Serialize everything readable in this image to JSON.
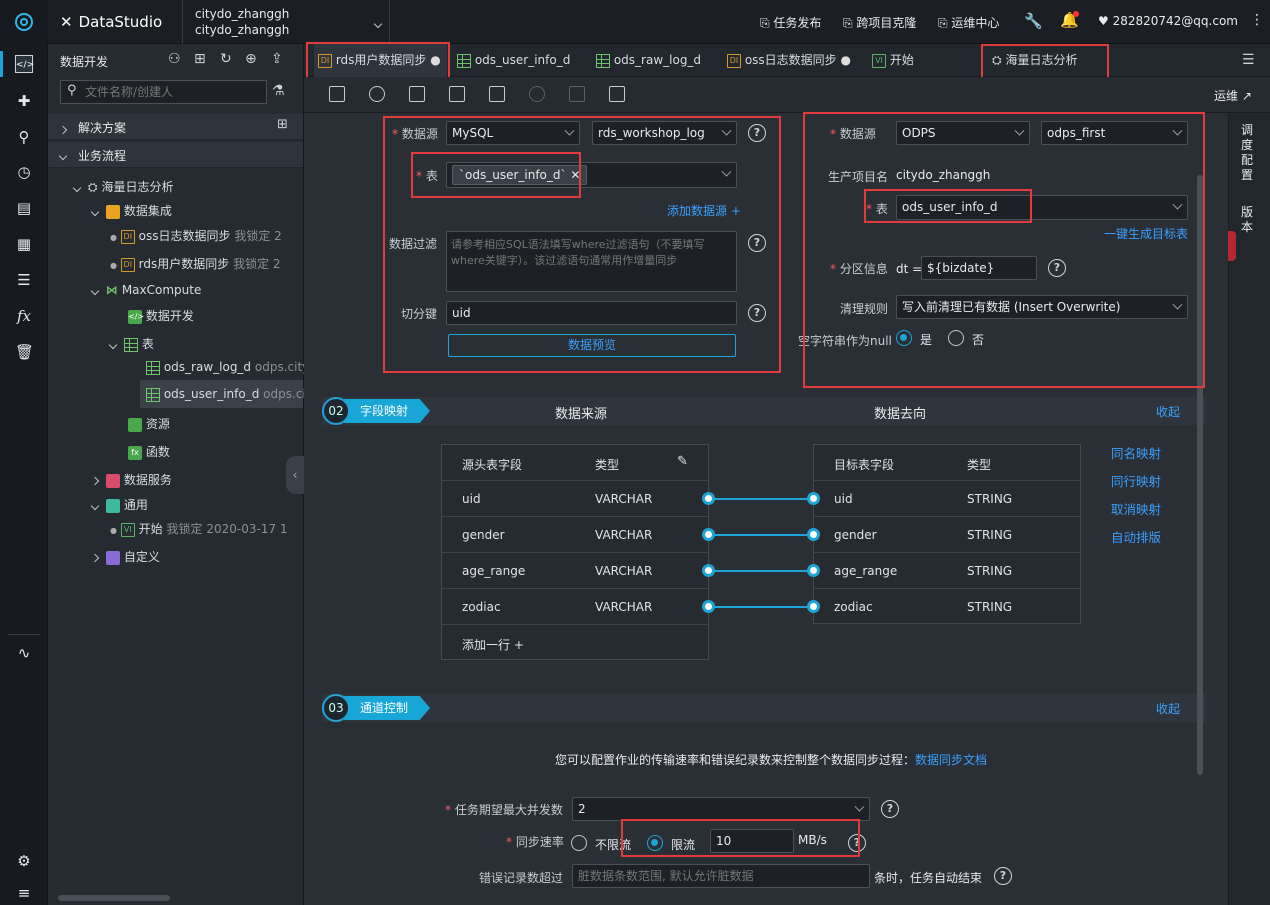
{
  "app": {
    "title": "DataStudio",
    "project_line1": "citydo_zhanggh",
    "project_line2": "citydo_zhanggh"
  },
  "topnav": {
    "task_publish": "任务发布",
    "cross_project_clone": "跨项目克隆",
    "ops_center": "运维中心",
    "user": "282820742@qq.com"
  },
  "sidebar": {
    "title": "数据开发",
    "search_placeholder": "文件名称/创建人",
    "sections": {
      "solutions": "解决方案",
      "business_flow": "业务流程"
    },
    "tree": {
      "flow": "海量日志分析",
      "data_integration": "数据集成",
      "oss_sync": "oss日志数据同步",
      "oss_lock": "我锁定",
      "oss_tail": "2",
      "rds_sync": "rds用户数据同步",
      "rds_lock": "我锁定",
      "rds_tail": "2",
      "maxcompute": "MaxCompute",
      "data_dev": "数据开发",
      "table_group": "表",
      "raw_log": "ods_raw_log_d",
      "raw_log_ns": "odps.city",
      "user_info": "ods_user_info_d",
      "user_info_ns": "odps.ci",
      "resource": "资源",
      "function": "函数",
      "data_service": "数据服务",
      "general": "通用",
      "start": "开始",
      "start_lock": "我锁定",
      "start_time": "2020-03-17 1",
      "custom": "自定义"
    }
  },
  "tabs": [
    {
      "label": "rds用户数据同步",
      "icon": "DI"
    },
    {
      "label": "ods_user_info_d",
      "icon": "table"
    },
    {
      "label": "ods_raw_log_d",
      "icon": "table"
    },
    {
      "label": "oss日志数据同步",
      "icon": "DI"
    },
    {
      "label": "开始",
      "icon": "VI"
    },
    {
      "label": "海量日志分析",
      "icon": "flow"
    }
  ],
  "toolbar": {
    "ops_link": "运维"
  },
  "rightbar": {
    "schedule": "调度配置",
    "version": "版本"
  },
  "source": {
    "datasource_label": "数据源",
    "datasource_type": "MySQL",
    "datasource_name": "rds_workshop_log",
    "table_label": "表",
    "table_chip": "`ods_user_info_d`",
    "add_datasource": "添加数据源 +",
    "filter_label": "数据过滤",
    "filter_placeholder": "请参考相应SQL语法填写where过滤语句（不要填写where关键字）。该过滤语句通常用作增量同步",
    "split_label": "切分键",
    "split_value": "uid",
    "preview_button": "数据预览"
  },
  "target": {
    "datasource_label": "数据源",
    "datasource_type": "ODPS",
    "datasource_name": "odps_first",
    "project_label": "生产项目名",
    "project_value": "citydo_zhanggh",
    "table_label": "表",
    "table_value": "ods_user_info_d",
    "gen_target": "一键生成目标表",
    "partition_label": "分区信息",
    "partition_prefix": "dt =",
    "partition_value": "${bizdate}",
    "clean_label": "清理规则",
    "clean_value": "写入前清理已有数据 (Insert Overwrite)",
    "null_label": "空字符串作为null",
    "null_yes": "是",
    "null_no": "否"
  },
  "mapping": {
    "num": "02",
    "label": "字段映射",
    "source_title": "数据来源",
    "target_title": "数据去向",
    "collapse": "收起",
    "src_header_field": "源头表字段",
    "src_header_type": "类型",
    "dst_header_field": "目标表字段",
    "dst_header_type": "类型",
    "src_rows": [
      {
        "field": "uid",
        "type": "VARCHAR"
      },
      {
        "field": "gender",
        "type": "VARCHAR"
      },
      {
        "field": "age_range",
        "type": "VARCHAR"
      },
      {
        "field": "zodiac",
        "type": "VARCHAR"
      }
    ],
    "dst_rows": [
      {
        "field": "uid",
        "type": "STRING"
      },
      {
        "field": "gender",
        "type": "STRING"
      },
      {
        "field": "age_range",
        "type": "STRING"
      },
      {
        "field": "zodiac",
        "type": "STRING"
      }
    ],
    "add_row": "添加一行 +",
    "actions": {
      "same_name": "同名映射",
      "same_row": "同行映射",
      "cancel": "取消映射",
      "auto_layout": "自动排版"
    }
  },
  "channel": {
    "num": "03",
    "label": "通道控制",
    "collapse": "收起",
    "desc": "您可以配置作业的传输速率和错误纪录数来控制整个数据同步过程：",
    "doc_link": "数据同步文档",
    "concurrency_label": "任务期望最大并发数",
    "concurrency_value": "2",
    "speed_label": "同步速率",
    "speed_unlimited": "不限流",
    "speed_limited": "限流",
    "speed_value": "10",
    "speed_unit": "MB/s",
    "error_label": "错误记录数超过",
    "error_placeholder": "脏数据条数范围, 默认允许脏数据",
    "error_suffix": "条时，任务自动结束"
  }
}
